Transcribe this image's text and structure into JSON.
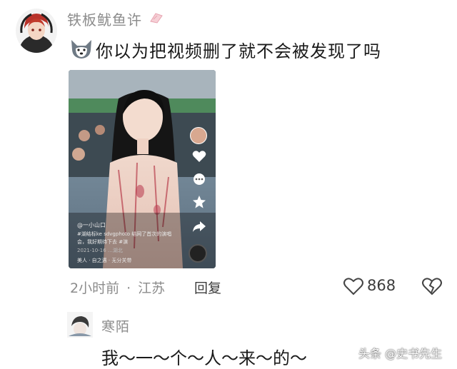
{
  "comment1": {
    "username": "铁板鱿鱼许",
    "text": "你以为把视频删了就不会被发现了吗",
    "video": {
      "caption_lines": [
        "@一小山口",
        "#湖结标ke sdvgphoto 结网了首次的演唱",
        "会，我好期待下去 #演",
        "2021-10-16 …湖北",
        "美人 · 自之遇 · 无分关带"
      ]
    },
    "time": "2小时前",
    "location": "江苏",
    "reply_label": "回复",
    "like_count": "868"
  },
  "comment2": {
    "username": "寒陌",
    "text": "我～一～个～人～来～的～"
  },
  "watermark": "头条 @史书先生",
  "icons": {
    "like": "heart-outline-icon",
    "dislike": "broken-heart-icon",
    "badge": "level-badge-icon",
    "emoji": "dog-emoji-icon"
  },
  "colors": {
    "muted": "#8c8c8c",
    "text": "#1a1a1a"
  }
}
